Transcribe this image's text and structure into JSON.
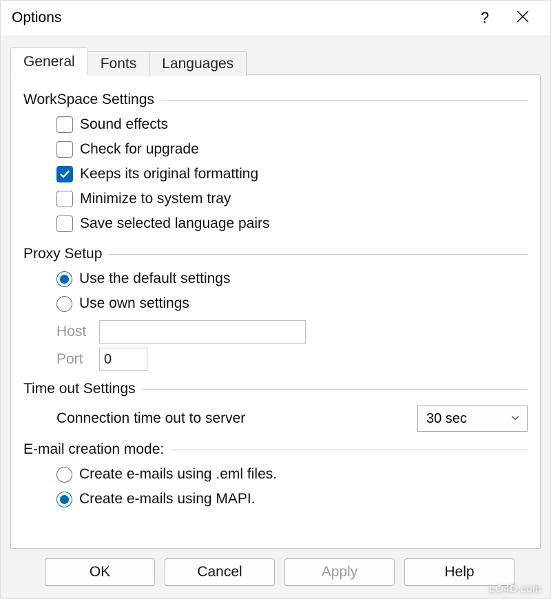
{
  "window": {
    "title": "Options"
  },
  "tabs": [
    {
      "label": "General",
      "active": true
    },
    {
      "label": "Fonts",
      "active": false
    },
    {
      "label": "Languages",
      "active": false
    }
  ],
  "groups": {
    "workspace": {
      "title": "WorkSpace Settings",
      "options": [
        {
          "label": "Sound effects",
          "checked": false
        },
        {
          "label": "Check for upgrade",
          "checked": false
        },
        {
          "label": "Keeps its original formatting",
          "checked": true
        },
        {
          "label": "Minimize to system tray",
          "checked": false
        },
        {
          "label": "Save selected language pairs",
          "checked": false
        }
      ]
    },
    "proxy": {
      "title": "Proxy Setup",
      "options": [
        {
          "label": "Use the default settings",
          "selected": true
        },
        {
          "label": "Use own settings",
          "selected": false
        }
      ],
      "host": {
        "label": "Host",
        "value": ""
      },
      "port": {
        "label": "Port",
        "value": "0"
      }
    },
    "timeout": {
      "title": "Time out Settings",
      "label": "Connection time out  to server",
      "value": "30 sec"
    },
    "email": {
      "title": "E-mail creation mode:",
      "options": [
        {
          "label": "Create e-mails using .eml files.",
          "selected": false
        },
        {
          "label": "Create e-mails using MAPI.",
          "selected": true
        }
      ]
    }
  },
  "buttons": {
    "ok": "OK",
    "cancel": "Cancel",
    "apply": "Apply",
    "help": "Help"
  },
  "watermark": "LO4D.com"
}
